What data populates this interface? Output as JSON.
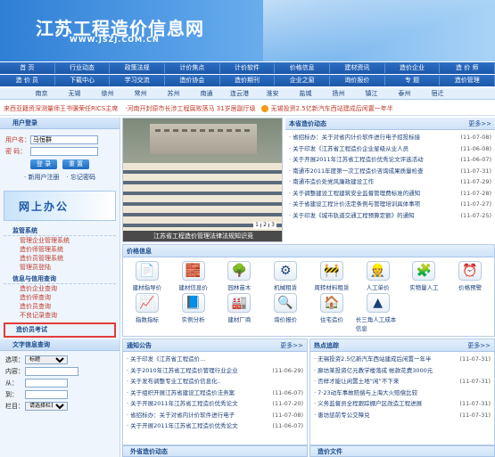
{
  "site": {
    "title": "江苏工程造价信息网",
    "url": "WWW.JSZJ.COM.CN"
  },
  "nav1": [
    "首 页",
    "行业动态",
    "政策法规",
    "计价焦点",
    "计价软件",
    "价格信息",
    "建材资讯",
    "造价企业",
    "造 价 师"
  ],
  "nav2": [
    "造 价 员",
    "下载中心",
    "学习交流",
    "造价协会",
    "造价期刊",
    "企业之窗",
    "询价报价",
    "专 题",
    "造价管理"
  ],
  "cities": [
    "南京",
    "无锡",
    "徐州",
    "常州",
    "苏州",
    "南通",
    "连云港",
    "淮安",
    "盐城",
    "扬州",
    "镇江",
    "泰州",
    "宿迁"
  ],
  "ticker": [
    "来西亚籍资深测量师王书骥荣任RICS主席",
    "·河南开封原市长涉工程腐败落马 31岁居副厅级",
    "无锡投资2.5亿新汽车西站建成后闲置一年半"
  ],
  "login": {
    "head": "用户登录",
    "user_label": "用户名：",
    "user_value": "马恒群",
    "pwd_label": "密 码：",
    "login": "登 录",
    "reset": "重 置",
    "register": "· 新用户注册",
    "forgot": "· 忘记密码"
  },
  "online": "网上办公",
  "s1": {
    "title": "监管系统",
    "items": [
      "管理企业管理系统",
      "造价师管理系统",
      "造价员管理系统",
      "管理员登陆"
    ]
  },
  "s2": {
    "title": "信息与信用查询",
    "items": [
      "造价企业查询",
      "造价师查询",
      "造价员查询",
      "不良记录查询"
    ]
  },
  "exam": "造价员考试",
  "query": {
    "title": "文字信息查询",
    "type_label": "选项：",
    "type_value": "标题",
    "content_label": "内容：",
    "from_label": "从：",
    "to_label": "到：",
    "col_label": "栏目：",
    "col_value": "请选择栏目"
  },
  "photo": {
    "caption": "江苏省工程造价管理法律法规知识竞",
    "pages": [
      "1",
      "2",
      "3"
    ]
  },
  "news": {
    "title": "本省造价动态",
    "more": "更多>>",
    "items": [
      {
        "t": "· 省招标办：关于对省内计价软件进行电子招投标接",
        "d": "(11-07-08)"
      },
      {
        "t": "· 关于印发《江苏省工程造价企业星级从业人员",
        "d": "(11-06-08)"
      },
      {
        "t": "· 关于开展2011年江苏省工程造价优秀论文评选活动",
        "d": "(11-06-07)"
      },
      {
        "t": "· 南通市2011年度第一次工程造价咨询成果质量检查",
        "d": "(11-07-31)"
      },
      {
        "t": "· 南通市造价处党风廉政建设工作",
        "d": "(11-07-29)"
      },
      {
        "t": "· 关于调整建设工程建筑安全监督管理费标准的通知",
        "d": "(11-07-28)"
      },
      {
        "t": "· 关于省建设工程计价法定条例与管理培训具体事项",
        "d": "(11-07-27)"
      },
      {
        "t": "· 关于印发《城市轨道交通工程预算定额》的通知",
        "d": "(11-07-25)"
      }
    ]
  },
  "price": {
    "title": "价格信息",
    "items": [
      "建材指导价",
      "建材信息价",
      "园林苗木",
      "机械租赁",
      "周转材料租赁",
      "人工单价",
      "实物量人工",
      "价格预警",
      "指数指标",
      "实例分析",
      "建材厂商",
      "询价报价",
      "住宅造价",
      "长三角人工成本信息"
    ]
  },
  "notice": {
    "title": "通知公告",
    "more": "更多>>",
    "items": [
      "· 关于印发《江苏省工程造价...",
      "· 关于2010年江苏省工程造价管理行业企业",
      "· 关于发布调整专业工程造价信息化..",
      "· 关于组织开展江苏省建设工程造价法务案",
      "· 关于开展2011年江苏省工程造价优秀论文",
      "· 省招标办：关于对省内计价软件进行电子",
      "· 关于开展2011年江苏省工程造价优秀论文"
    ],
    "dates": [
      "",
      "(11-06-29)",
      "",
      "(11-06-07)",
      "(11-07-20)",
      "(11-07-08)",
      "(11-06-07)"
    ]
  },
  "hot": {
    "title": "热点追踪",
    "more": "更多>>",
    "items": [
      "· 无锡投资2.5亿新汽车西站建成后闲置一年半",
      "· 廊坊某投资亿元教学楼落成 帐款花费3000元",
      "· 否样才能让闲置土地“闲”不下来",
      "· 7·23动车事故赔偿与上海大火赔偿比较",
      "· 义务监督员全程跟踪棚户区改造工程进展",
      "· 患坊惩前专公交障兑"
    ],
    "dates": [
      "(11-07-31)",
      "",
      "(11-07-31)",
      "",
      "(11-07-31)",
      "(11-07-31)"
    ]
  },
  "bottom": {
    "b1": "外省造价动态",
    "b2": "造价文件"
  }
}
